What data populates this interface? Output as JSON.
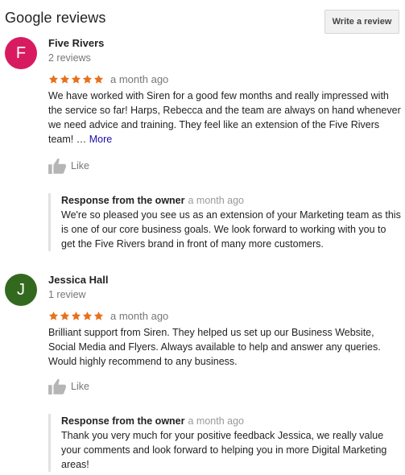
{
  "header": {
    "title": "Google reviews",
    "write_button": "Write a review"
  },
  "accent": {
    "star_color": "#e7711b",
    "link_color": "#1a0dab"
  },
  "reviews": [
    {
      "avatar_letter": "F",
      "avatar_color": "#d81b60",
      "name": "Five Rivers",
      "count": "2 reviews",
      "rating": 5,
      "date": "a month ago",
      "text": "We have worked with Siren for a good few months and really impressed with the service so far! Harps, Rebecca and the team are always on hand whenever we need advice and training. They feel like an extension of the Five Rivers team! …",
      "more": "More",
      "like": "Like",
      "response": {
        "label": "Response from the owner",
        "date": "a month ago",
        "text": "We're so pleased you see us as an extension of your Marketing team as this is one of our core business goals. We look forward to working with you to get the Five Rivers brand in front of many more customers."
      }
    },
    {
      "avatar_letter": "J",
      "avatar_color": "#33691e",
      "name": "Jessica Hall",
      "count": "1 review",
      "rating": 5,
      "date": "a month ago",
      "text": "Brilliant support from Siren.  They helped us set up our Business Website, Social Media and Flyers.  Always available to help and answer any queries.  Would highly recommend to any business.",
      "like": "Like",
      "response": {
        "label": "Response from the owner",
        "date": "a month ago",
        "text": "Thank you very much for your positive feedback Jessica, we really value your comments and look forward to helping you in more Digital Marketing areas!"
      }
    }
  ]
}
